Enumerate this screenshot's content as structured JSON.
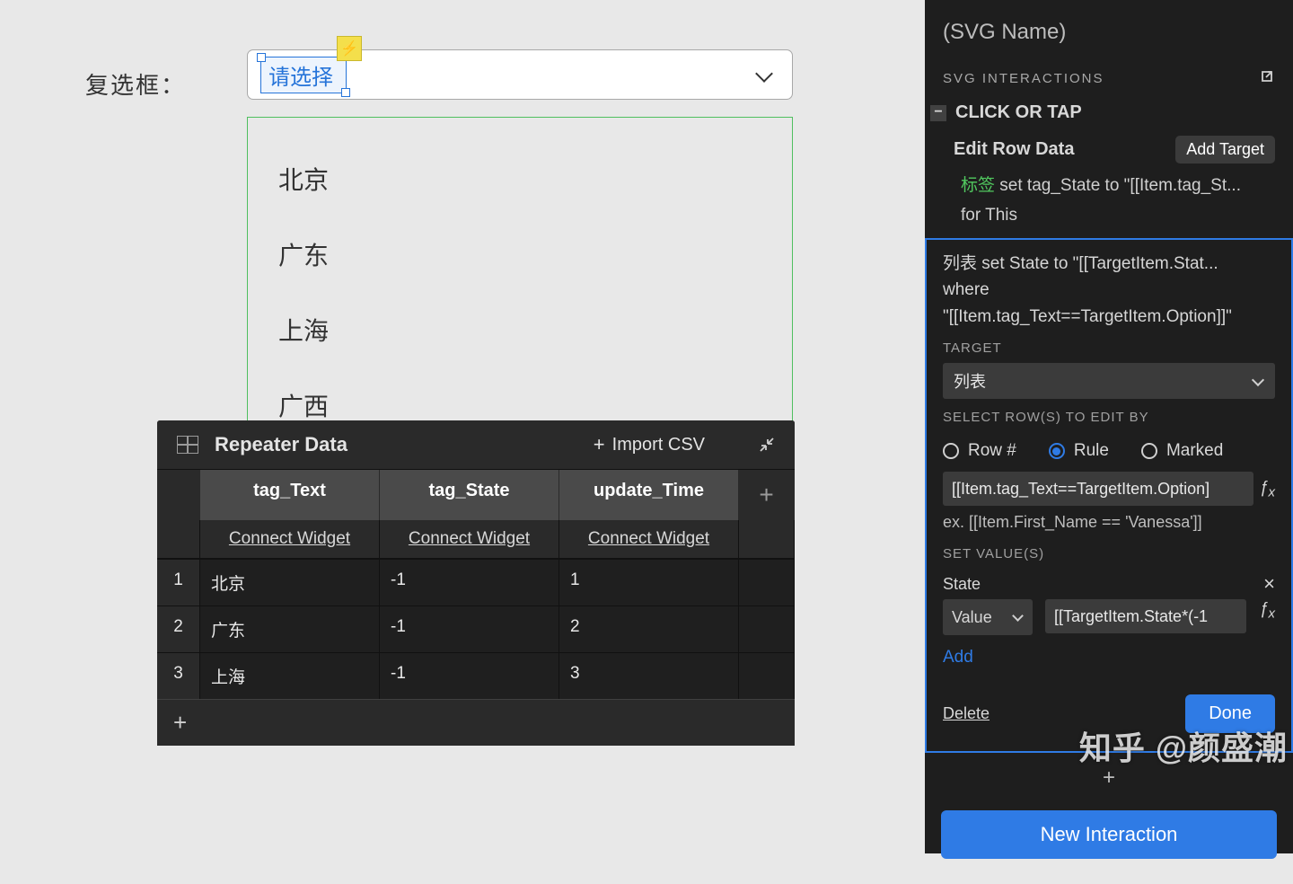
{
  "canvas": {
    "field_label": "复选框：",
    "dropdown_placeholder": "请选择",
    "options": [
      "北京",
      "广东",
      "上海",
      "广西"
    ]
  },
  "repeater": {
    "title": "Repeater Data",
    "import_label": "Import CSV",
    "columns": [
      "tag_Text",
      "tag_State",
      "update_Time"
    ],
    "connect_label": "Connect Widget",
    "rows": [
      {
        "n": "1",
        "cells": [
          "北京",
          "-1",
          "1"
        ]
      },
      {
        "n": "2",
        "cells": [
          "广东",
          "-1",
          "2"
        ]
      },
      {
        "n": "3",
        "cells": [
          "上海",
          "-1",
          "3"
        ]
      }
    ]
  },
  "inspector": {
    "svg_name": "(SVG Name)",
    "section_header": "SVG INTERACTIONS",
    "event": "CLICK OR TAP",
    "action_title": "Edit Row Data",
    "add_target_btn": "Add Target",
    "line1_tag": "标签",
    "line1_rest": " set tag_State to \"[[Item.tag_St...",
    "line1b": "for This",
    "box_desc_l1": "列表 set State to \"[[TargetItem.Stat...",
    "box_desc_l2": "where",
    "box_desc_l3": "\"[[Item.tag_Text==TargetItem.Option]]\"",
    "target_label": "TARGET",
    "target_value": "列表",
    "select_rows_label": "SELECT ROW(S) TO EDIT BY",
    "radio_row_num": "Row #",
    "radio_rule": "Rule",
    "radio_marked": "Marked",
    "rule_expr": "[[Item.tag_Text==TargetItem.Option]",
    "rule_hint": "ex. [[Item.First_Name == 'Vanessa']]",
    "set_values_label": "SET VALUE(S)",
    "set_values_field": "State",
    "value_select": "Value",
    "value_expr": "[[TargetItem.State*(-1",
    "add_link": "Add",
    "delete_link": "Delete",
    "done_btn": "Done",
    "new_interaction_btn": "New Interaction"
  },
  "watermark": "知乎 @颜盛潮"
}
